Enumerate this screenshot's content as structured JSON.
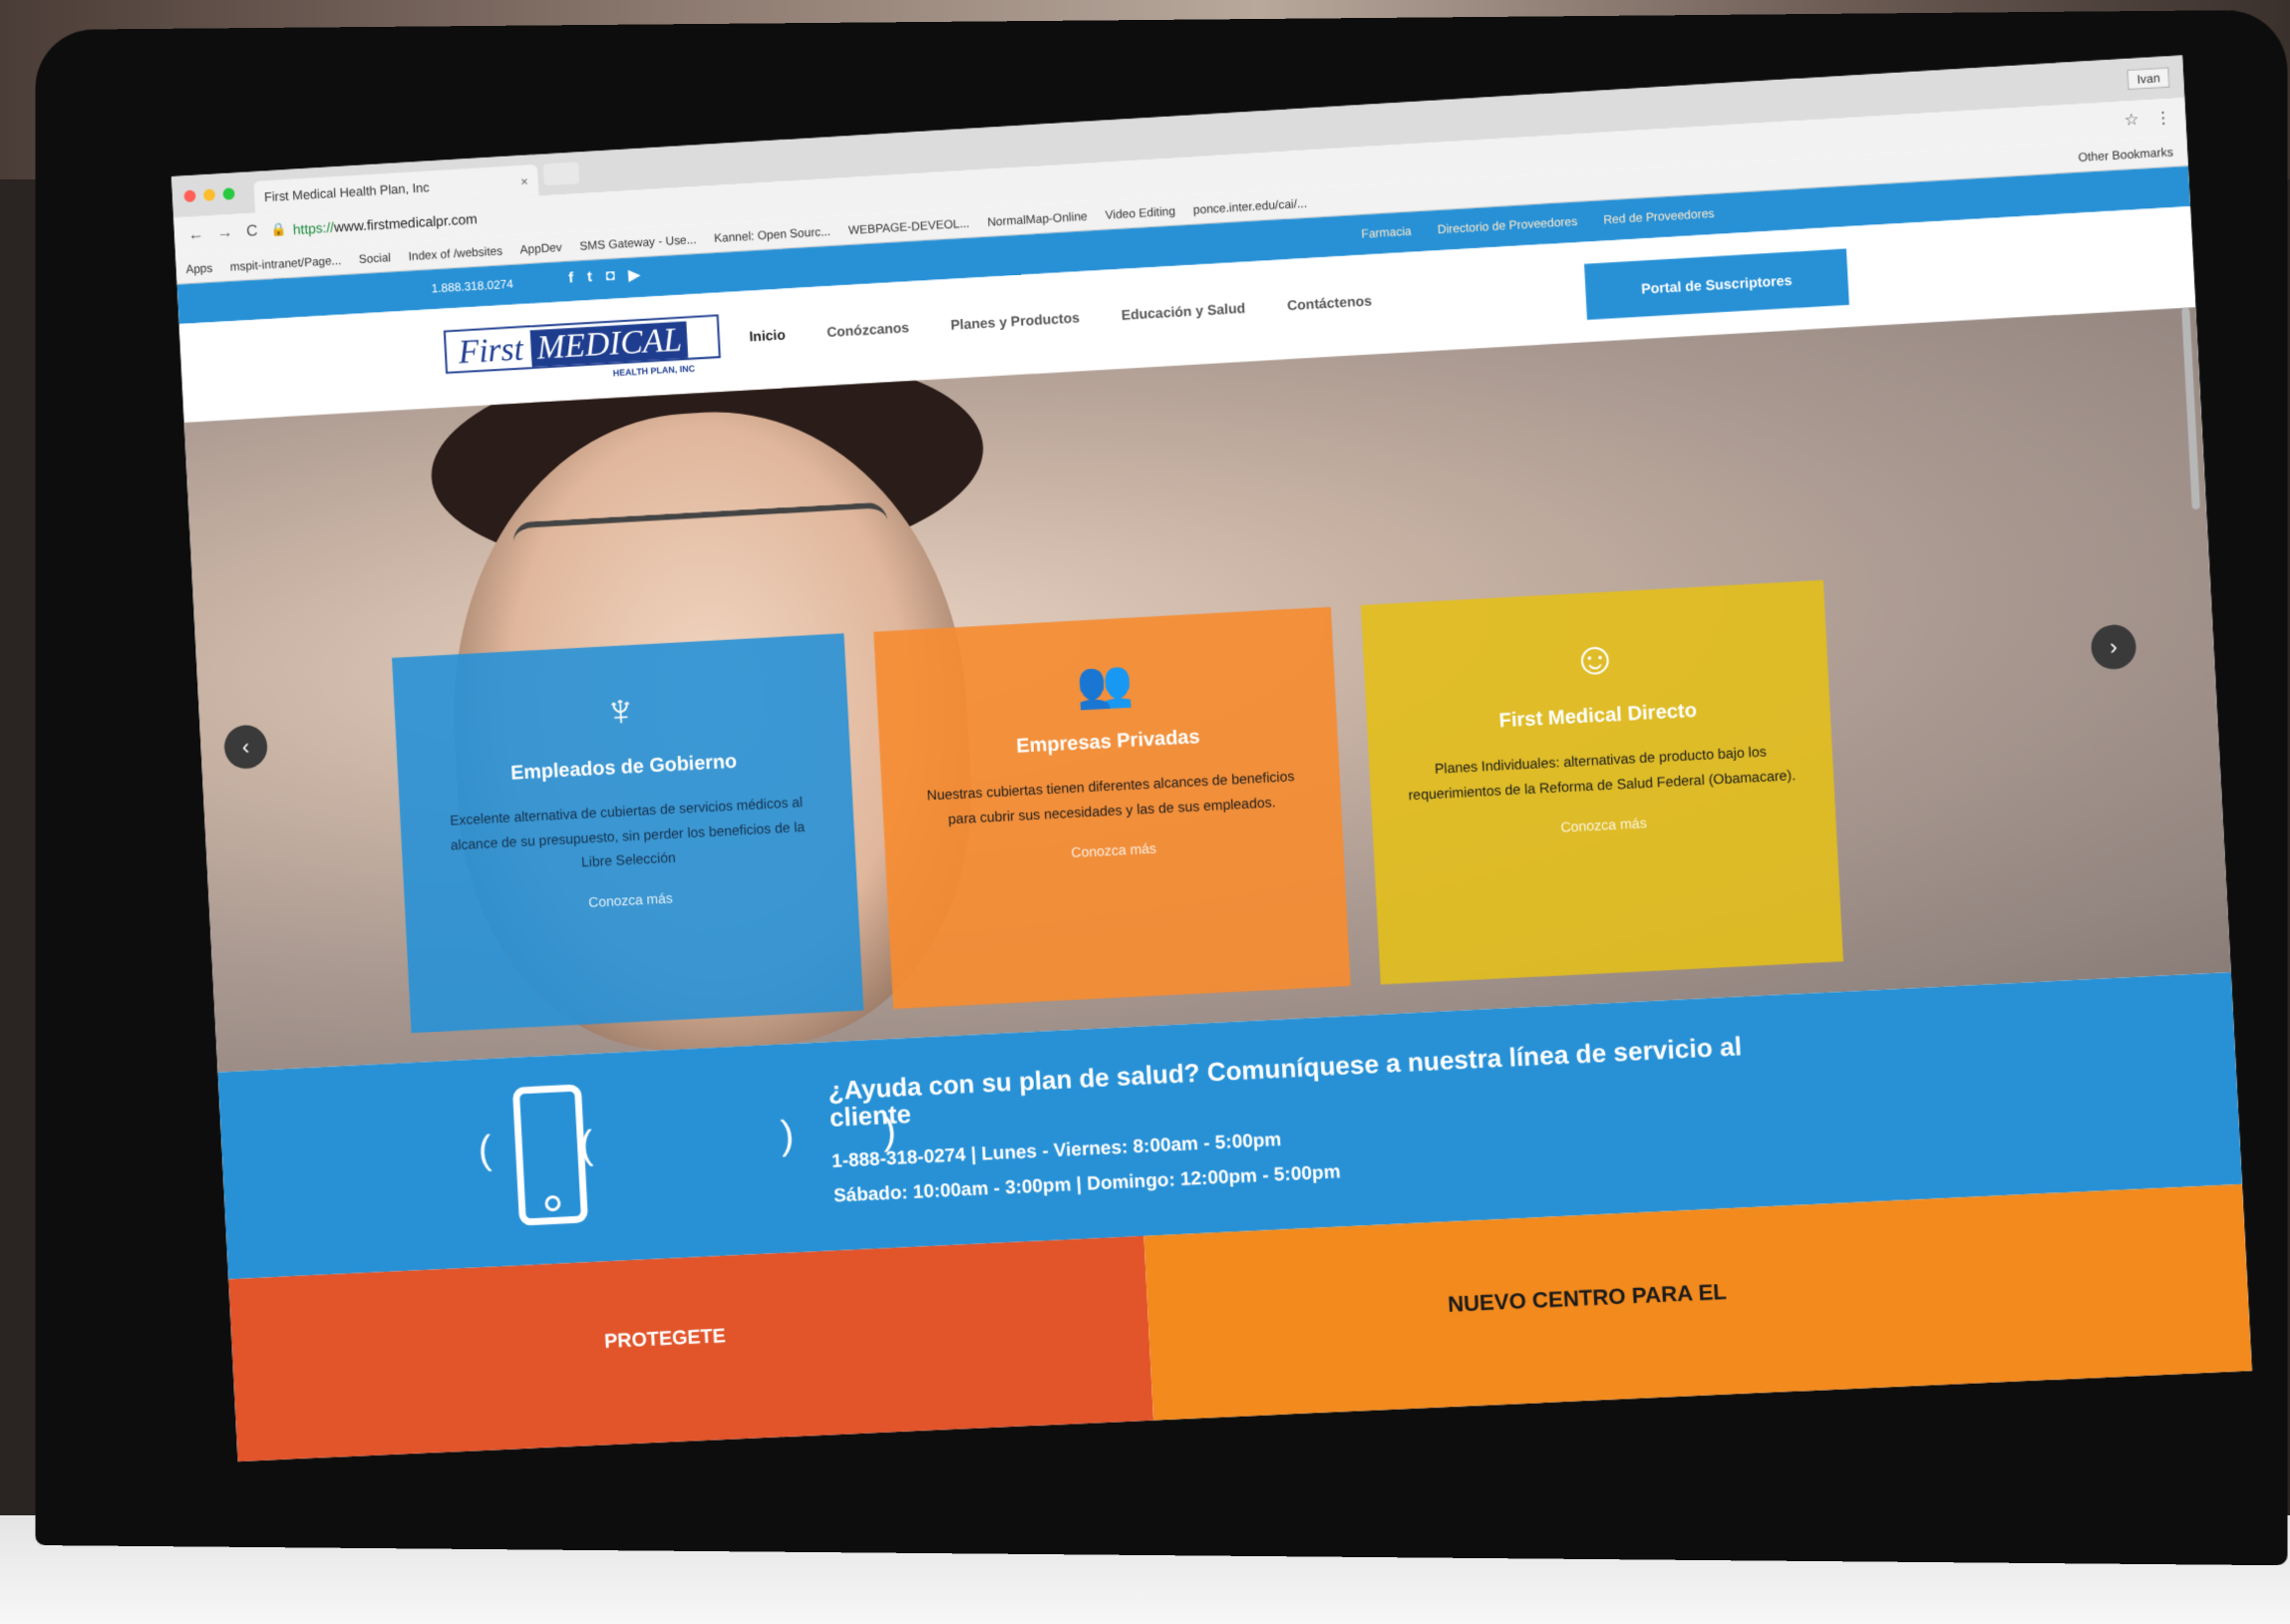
{
  "browser": {
    "tab_title": "First Medical Health Plan, Inc",
    "tab_close": "×",
    "user": "Ivan",
    "url_protocol": "https://",
    "url_host": "www.firstmedicalpr.com",
    "bookmarks": [
      "Apps",
      "mspit-intranet/Page...",
      "Social",
      "Index of /websites",
      "AppDev",
      "SMS Gateway - Use...",
      "Kannel: Open Sourc...",
      "WEBPAGE-DEVEOL...",
      "NormalMap-Online",
      "Video Editing",
      "ponce.inter.edu/cai/..."
    ],
    "other_bookmarks": "Other Bookmarks"
  },
  "site": {
    "topbar": {
      "phone": "1.888.318.0274",
      "links": [
        "Farmacia",
        "Directorio de Proveedores",
        "Red de Proveedores"
      ]
    },
    "logo": {
      "first": "First",
      "medical": "MEDICAL",
      "sub": "HEALTH PLAN, INC"
    },
    "nav": [
      "Inicio",
      "Conózcanos",
      "Planes y Productos",
      "Educación y Salud",
      "Contáctenos"
    ],
    "portal_button": "Portal de Suscriptores",
    "cards": [
      {
        "title": "Empleados de Gobierno",
        "text": "Excelente alternativa de cubiertas de servicios médicos al alcance de su presupuesto, sin perder los beneficios de la Libre Selección",
        "more": "Conozca más",
        "icon": "tie-icon"
      },
      {
        "title": "Empresas Privadas",
        "text": "Nuestras cubiertas tienen diferentes alcances de beneficios para cubrir sus necesidades y las de sus empleados.",
        "more": "Conozca más",
        "icon": "group-icon"
      },
      {
        "title": "First Medical Directo",
        "text": "Planes Individuales: alternativas de producto bajo los requerimientos de la Reforma de Salud Federal (Obamacare).",
        "more": "Conozca más",
        "icon": "person-icon"
      }
    ],
    "help": {
      "title": "¿Ayuda con su plan de salud? Comuníquese a nuestra línea de servicio al cliente",
      "line1": "1-888-318-0274 | Lunes - Viernes: 8:00am - 5:00pm",
      "line2": "Sábado: 10:00am - 3:00pm | Domingo: 12:00pm - 5:00pm"
    },
    "promos": [
      "PROTEGETE",
      "NUEVO CENTRO PARA EL"
    ]
  }
}
